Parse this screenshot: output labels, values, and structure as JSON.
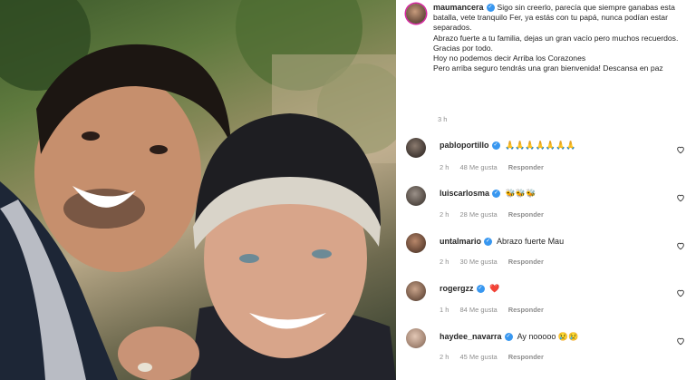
{
  "post": {
    "author": "maumancera",
    "caption_lines": [
      "Sigo sin creerlo, parecía que siempre ganabas esta batalla, vete tranquilo Fer, ya estás con tu papá, nunca podían estar separados.",
      "Abrazo fuerte a tu familia, dejas un gran vacío pero muchos recuerdos.",
      "Gracias por todo.",
      "Hoy no podemos decir Arriba los Corazones",
      "Pero arriba seguro tendrás una gran bienvenida! Descansa en paz"
    ],
    "time": "3 h"
  },
  "comments": [
    {
      "user": "pabloportillo",
      "verified": true,
      "text": "🙏🙏🙏🙏🙏🙏🙏",
      "time": "2 h",
      "likes": "48 Me gusta",
      "reply": "Responder"
    },
    {
      "user": "luiscarlosma",
      "verified": true,
      "text": "🐝🐝🐝",
      "time": "2 h",
      "likes": "28 Me gusta",
      "reply": "Responder"
    },
    {
      "user": "untalmario",
      "verified": true,
      "text": "Abrazo fuerte Mau",
      "time": "2 h",
      "likes": "30 Me gusta",
      "reply": "Responder"
    },
    {
      "user": "rogergzz",
      "verified": true,
      "text": "❤️",
      "time": "1 h",
      "likes": "84 Me gusta",
      "reply": "Responder"
    },
    {
      "user": "haydee_navarra",
      "verified": true,
      "text": "Ay nooooo 😢😢",
      "time": "2 h",
      "likes": "45 Me gusta",
      "reply": "Responder"
    }
  ],
  "icons": {
    "verified": "verified-badge-icon",
    "like": "heart-outline-icon"
  },
  "colors": {
    "verified": "#3897f0",
    "muted": "#8e8e8e"
  }
}
